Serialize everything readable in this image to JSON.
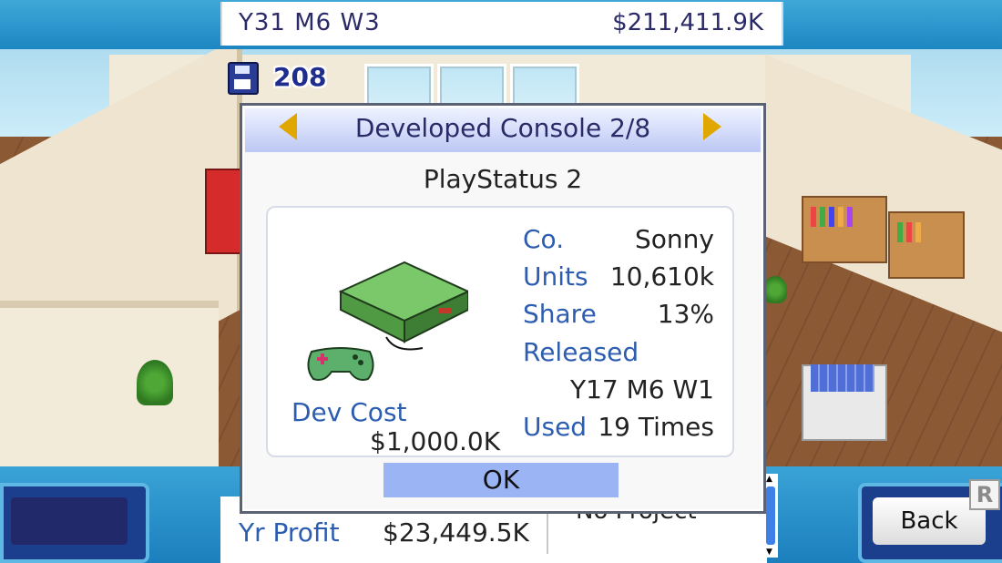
{
  "status": {
    "date": "Y31 M6 W3",
    "money": "$211,411.9K",
    "research_points": "208"
  },
  "dialog": {
    "title": "Developed Console 2/8",
    "console_name": "PlayStatus 2",
    "company_label": "Co.",
    "company_value": "Sonny",
    "units_label": "Units",
    "units_value": "10,610k",
    "share_label": "Share",
    "share_value": "13%",
    "released_label": "Released",
    "released_value": "Y17 M6 W1",
    "used_label": "Used",
    "used_value": "19 Times",
    "dev_cost_label": "Dev Cost",
    "dev_cost_value": "$1,000.0K",
    "ok_label": "OK"
  },
  "bottom": {
    "yr_profit_label": "Yr Profit",
    "yr_profit_value": "$23,449.5K",
    "project_text": "No Project",
    "back_label": "Back",
    "r_badge": "R"
  },
  "colors": {
    "accent_blue": "#2d5db1",
    "title_navy": "#2b2a68",
    "ok_button": "#9bb4f4",
    "arrow_gold": "#e0a700",
    "bar_blue": "#1d86c2"
  },
  "icons": {
    "save": "floppy-disk-icon",
    "prev": "arrow-left-icon",
    "next": "arrow-right-icon"
  }
}
